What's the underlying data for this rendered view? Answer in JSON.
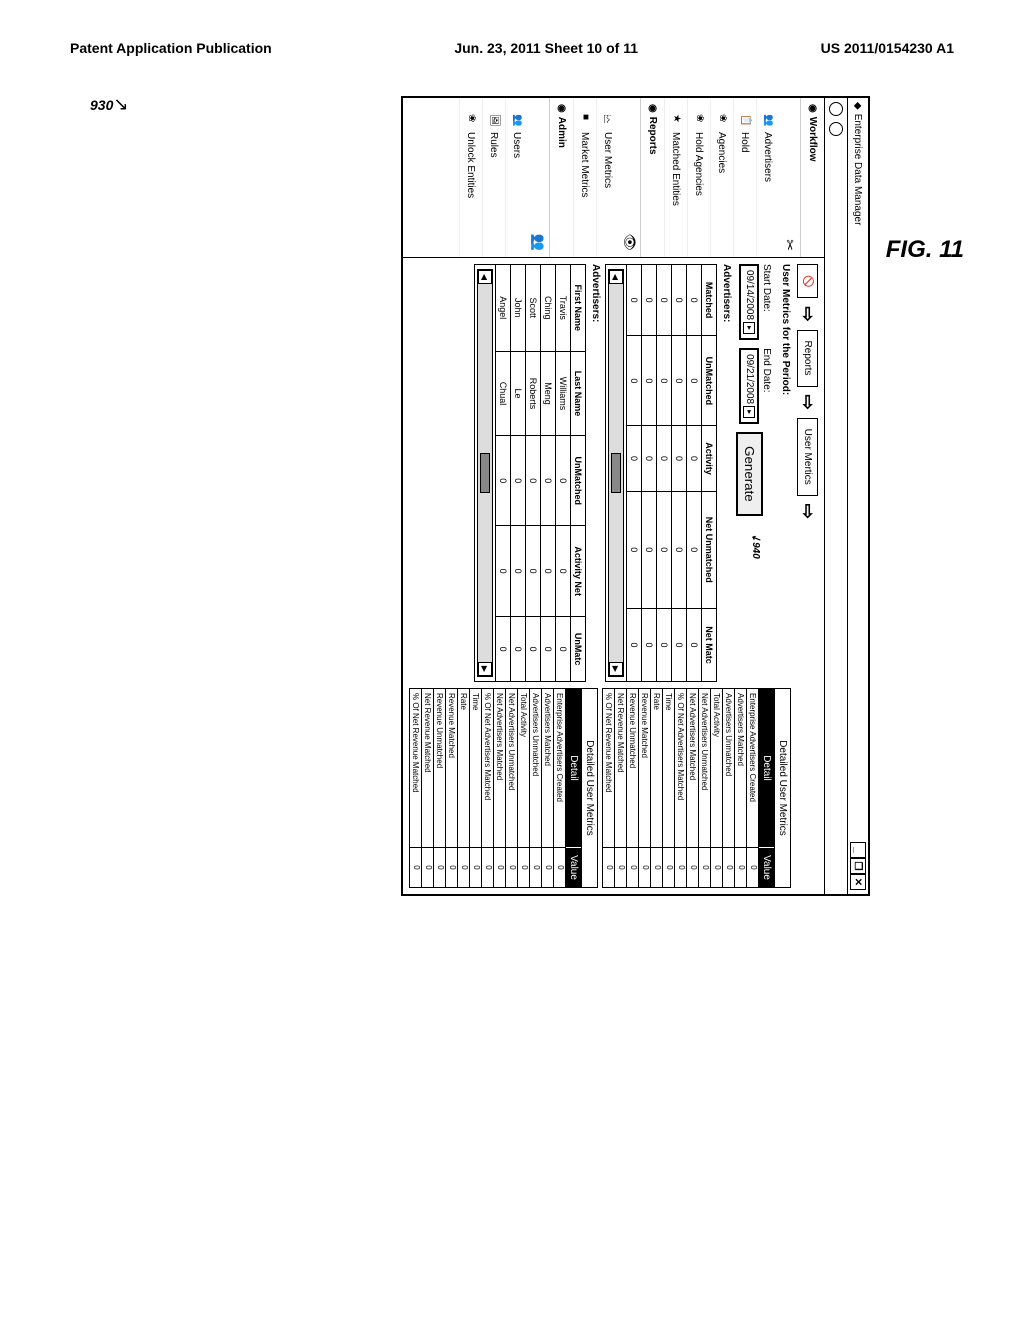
{
  "page_header": {
    "left": "Patent Application Publication",
    "center": "Jun. 23, 2011  Sheet 10 of 11",
    "right": "US 2011/0154230 A1"
  },
  "figure": {
    "ref_930": "930",
    "ref_940": "940",
    "caption": "FIG. 11"
  },
  "window": {
    "title": "Enterprise Data Manager",
    "min": "_",
    "restore": "❐",
    "close": "✕"
  },
  "sidebar": {
    "workflow": {
      "header": "Workflow",
      "items": [
        {
          "icon": "👥",
          "label": "Advertisers"
        },
        {
          "icon": "📋",
          "label": "Hold"
        },
        {
          "icon": "❀",
          "label": "Agencies"
        },
        {
          "icon": "❀",
          "label": "Hold Agencies"
        },
        {
          "icon": "★",
          "label": "Matched Entities"
        }
      ]
    },
    "reports": {
      "header": "Reports",
      "items": [
        {
          "icon": "🗠",
          "label": "User Metrics"
        },
        {
          "icon": "■",
          "label": "Market Metrics"
        }
      ]
    },
    "admin": {
      "header": "Admin",
      "items": [
        {
          "icon": "👥",
          "label": "Users"
        },
        {
          "icon": "🖼",
          "label": "Rules"
        },
        {
          "icon": "❀",
          "label": "Unlock Entities"
        }
      ]
    }
  },
  "breadcrumb": {
    "item1": "Reports",
    "item2": "User Mertics"
  },
  "period": {
    "title": "User Metrics for the Period:",
    "start_label": "Start Date:",
    "start_value": "09/14/2008",
    "end_label": "End Date:",
    "end_value": "09/21/2008",
    "generate": "Generate"
  },
  "advertisers_label": "Advertisers:",
  "table1": {
    "headers": [
      "Matched",
      "UnMatched",
      "Activity",
      "Net Unmatched",
      "Net Matc"
    ],
    "rows": [
      [
        "0",
        "0",
        "0",
        "0",
        "0"
      ],
      [
        "0",
        "0",
        "0",
        "0",
        "0"
      ],
      [
        "0",
        "0",
        "0",
        "0",
        "0"
      ],
      [
        "0",
        "0",
        "0",
        "0",
        "0"
      ],
      [
        "0",
        "0",
        "0",
        "0",
        "0"
      ]
    ]
  },
  "table2": {
    "headers": [
      "First Name",
      "Last Name",
      "UnMatched",
      "Activity Net",
      "UnMatc"
    ],
    "rows": [
      [
        "Travis",
        "Williams",
        "0",
        "0",
        "0"
      ],
      [
        "Ching",
        "Meng",
        "0",
        "0",
        "0"
      ],
      [
        "Scott",
        "Roberts",
        "0",
        "0",
        "0"
      ],
      [
        "John",
        "Le",
        "0",
        "0",
        "0"
      ],
      [
        "Angel",
        "Chual",
        "0",
        "0",
        "0"
      ]
    ]
  },
  "metrics_panel_title": "Detailed User Metrics",
  "metrics_head_detail": "Detail",
  "metrics_head_value": "Value",
  "metrics_rows": [
    "Enterprise Advertisers Created",
    "Advertisers Matched",
    "Advertisers Unmatched",
    "Total Activity",
    "Net Advertisers Unmatched",
    "Net Advertisers Matched",
    "% Of Net Advertisers Matched",
    "Time",
    "Rate",
    "Revenue Matched",
    "Revenue Unmatched",
    "Net Revenue Matched",
    "% Of Net Revenue Matched"
  ],
  "metrics_value_zero": "0"
}
